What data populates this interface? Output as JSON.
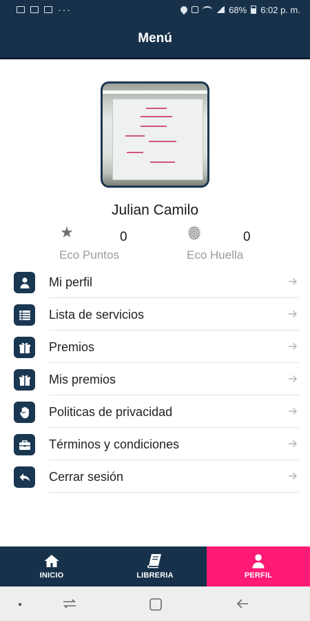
{
  "status_bar": {
    "time": "6:02 p. m.",
    "battery": "68%",
    "overflow": "···"
  },
  "header": {
    "title": "Menú"
  },
  "profile": {
    "name": "Julian Camilo",
    "stats": [
      {
        "value": "0",
        "label": "Eco Puntos",
        "icon": "star-icon"
      },
      {
        "value": "0",
        "label": "Eco Huella",
        "icon": "fingerprint-icon"
      }
    ]
  },
  "menu": {
    "items": [
      {
        "label": "Mi perfil",
        "icon": "person-icon"
      },
      {
        "label": "Lista de servicios",
        "icon": "list-icon"
      },
      {
        "label": "Premios",
        "icon": "gift-icon"
      },
      {
        "label": "Mis premios",
        "icon": "gift-icon"
      },
      {
        "label": "Politicas de privacidad",
        "icon": "hand-icon"
      },
      {
        "label": "Términos y condiciones",
        "icon": "briefcase-icon"
      },
      {
        "label": "Cerrar sesión",
        "icon": "reply-icon"
      }
    ]
  },
  "bottom_nav": {
    "tabs": [
      {
        "label": "INICIO",
        "icon": "home-icon",
        "active": false
      },
      {
        "label": "LIBRERIA",
        "icon": "book-icon",
        "active": false
      },
      {
        "label": "PERFIL",
        "icon": "person-icon",
        "active": true
      }
    ]
  },
  "colors": {
    "header": "#17314a",
    "accent": "#ff1a75",
    "icon_bg": "#1a3752"
  }
}
